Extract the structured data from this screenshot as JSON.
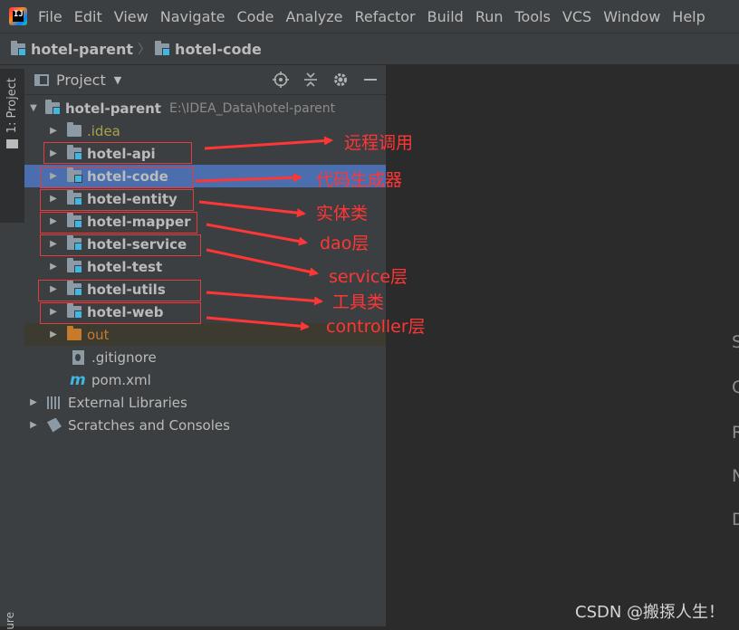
{
  "menu": {
    "items": [
      "File",
      "Edit",
      "View",
      "Navigate",
      "Code",
      "Analyze",
      "Refactor",
      "Build",
      "Run",
      "Tools",
      "VCS",
      "Window",
      "Help"
    ],
    "logo_letter": "IJ"
  },
  "breadcrumbs": [
    "hotel-parent",
    "hotel-code"
  ],
  "sidebar": {
    "project_tab": "1: Project",
    "bottom_tab": "ure"
  },
  "project_panel": {
    "title": "Project",
    "tools": [
      "locate-icon",
      "collapse-icon",
      "gear-icon",
      "minimize-icon"
    ]
  },
  "tree": {
    "root": {
      "name": "hotel-parent",
      "path": "E:\\IDEA_Data\\hotel-parent"
    },
    "items": [
      {
        "name": ".idea"
      },
      {
        "name": "hotel-api"
      },
      {
        "name": "hotel-code"
      },
      {
        "name": "hotel-entity"
      },
      {
        "name": "hotel-mapper"
      },
      {
        "name": "hotel-service"
      },
      {
        "name": "hotel-test"
      },
      {
        "name": "hotel-utils"
      },
      {
        "name": "hotel-web"
      },
      {
        "name": "out"
      },
      {
        "name": ".gitignore"
      },
      {
        "name": "pom.xml"
      }
    ],
    "external_libraries": "External Libraries",
    "scratches": "Scratches and Consoles"
  },
  "annotations": [
    "远程调用",
    "代码生成器",
    "实体类",
    "dao层",
    "service层",
    "工具类",
    "controller层"
  ],
  "editor": {
    "edge_letters": [
      "S",
      "G",
      "R",
      "N",
      "D"
    ]
  },
  "colors": {
    "annotation": "#ff3636",
    "selection": "#4b6eaf",
    "module_badge": "#40b6e0"
  },
  "watermark": "CSDN @搬揼人生！"
}
